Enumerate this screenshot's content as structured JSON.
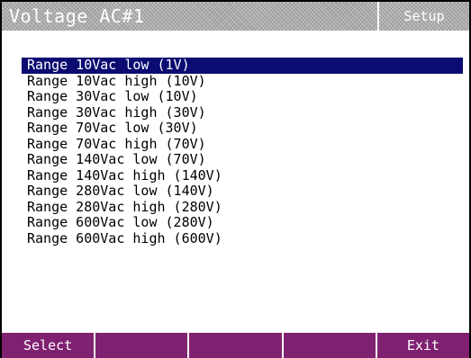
{
  "header": {
    "title": "Voltage AC#1",
    "mode": "Setup"
  },
  "menu": {
    "selected_index": 0,
    "items": [
      {
        "label": "Range 10Vac low (1V)"
      },
      {
        "label": "Range 10Vac high (10V)"
      },
      {
        "label": "Range 30Vac low (10V)"
      },
      {
        "label": "Range 30Vac high (30V)"
      },
      {
        "label": "Range 70Vac low (30V)"
      },
      {
        "label": "Range 70Vac high (70V)"
      },
      {
        "label": "Range 140Vac low (70V)"
      },
      {
        "label": "Range 140Vac high (140V)"
      },
      {
        "label": "Range 280Vac low (140V)"
      },
      {
        "label": "Range 280Vac high (280V)"
      },
      {
        "label": "Range 600Vac low (280V)"
      },
      {
        "label": "Range 600Vac high (600V)"
      }
    ]
  },
  "softkeys": [
    {
      "label": "Select"
    },
    {
      "label": ""
    },
    {
      "label": ""
    },
    {
      "label": ""
    },
    {
      "label": "Exit"
    }
  ],
  "colors": {
    "title_bar": "#a9a9a9",
    "selection_highlight": "#0b0b72",
    "softkey_bar": "#7f2170"
  }
}
